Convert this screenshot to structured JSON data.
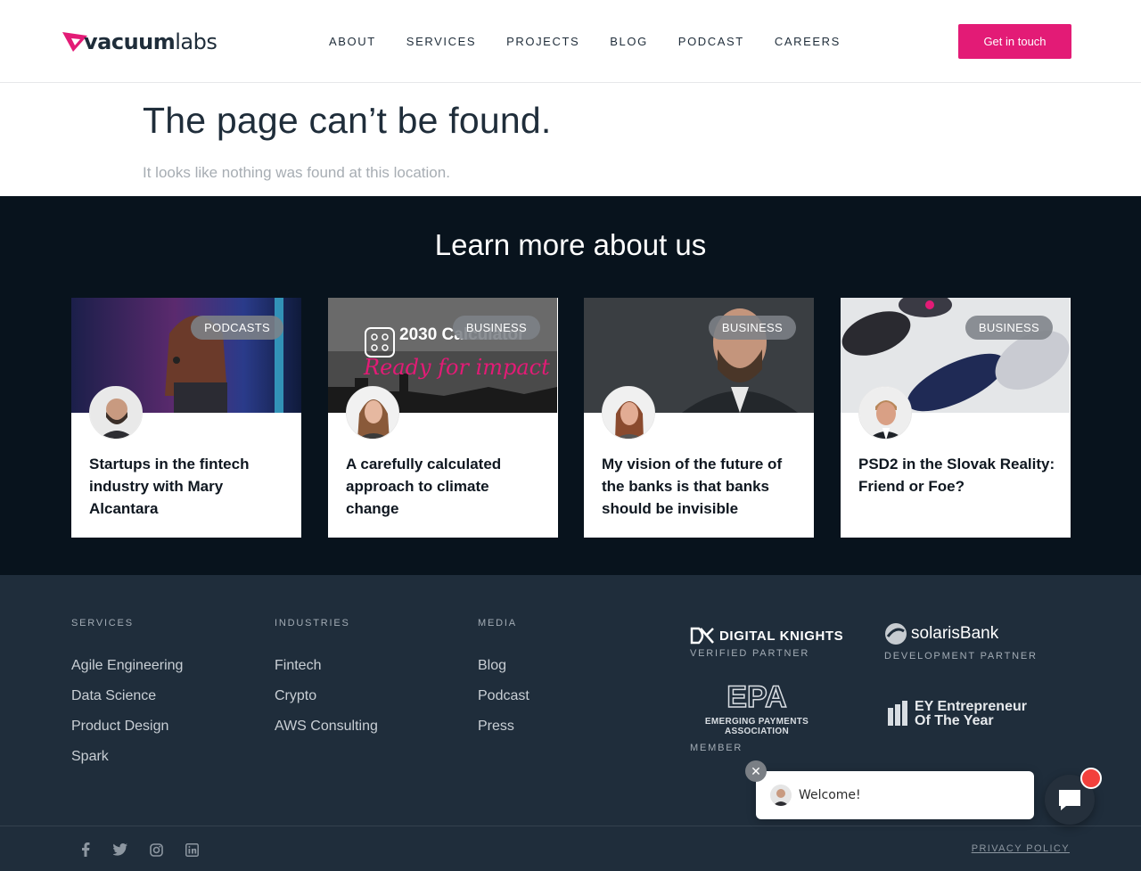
{
  "header": {
    "logo_text": "vacuumlabs",
    "nav": [
      "ABOUT",
      "SERVICES",
      "PROJECTS",
      "BLOG",
      "PODCAST",
      "CAREERS"
    ],
    "cta_label": "Get in touch"
  },
  "not_found": {
    "title": "The page can’t be found.",
    "subtitle": "It looks like nothing was found at this location."
  },
  "learn_more": {
    "heading": "Learn more about us",
    "cards": [
      {
        "badge": "PODCASTS",
        "title": "Startups in the fintech industry with Mary Alcantara"
      },
      {
        "badge": "BUSINESS",
        "title": "A carefully calculated approach to climate change",
        "image_text": "2030 Calculator",
        "image_script": "Ready for impact"
      },
      {
        "badge": "BUSINESS",
        "title": "My vision of the future of the banks is that banks should be invisible"
      },
      {
        "badge": "BUSINESS",
        "title": "PSD2 in the Slovak Reality: Friend or Foe?"
      }
    ]
  },
  "footer": {
    "services": {
      "heading": "SERVICES",
      "links": [
        "Agile Engineering",
        "Data Science",
        "Product Design",
        "Spark"
      ]
    },
    "industries": {
      "heading": "INDUSTRIES",
      "links": [
        "Fintech",
        "Crypto",
        "AWS Consulting"
      ]
    },
    "media": {
      "heading": "MEDIA",
      "links": [
        "Blog",
        "Podcast",
        "Press"
      ]
    },
    "partners": [
      {
        "name": "DIGITAL KNIGHTS",
        "label": "VERIFIED PARTNER"
      },
      {
        "name": "solarisBank",
        "label": "DEVELOPMENT PARTNER"
      },
      {
        "name": "EMERGING PAYMENTS ASSOCIATION",
        "label": "MEMBER"
      },
      {
        "name": "EY Entrepreneur Of The Year",
        "label": ""
      }
    ],
    "social_icons": [
      "facebook-icon",
      "twitter-icon",
      "instagram-icon",
      "linkedin-icon"
    ],
    "privacy_label": "PRIVACY POLICY"
  },
  "chat": {
    "welcome": "Welcome!"
  },
  "colors": {
    "accent": "#e31b76",
    "dark_section": "#08131d",
    "footer": "#1f2d3b"
  }
}
